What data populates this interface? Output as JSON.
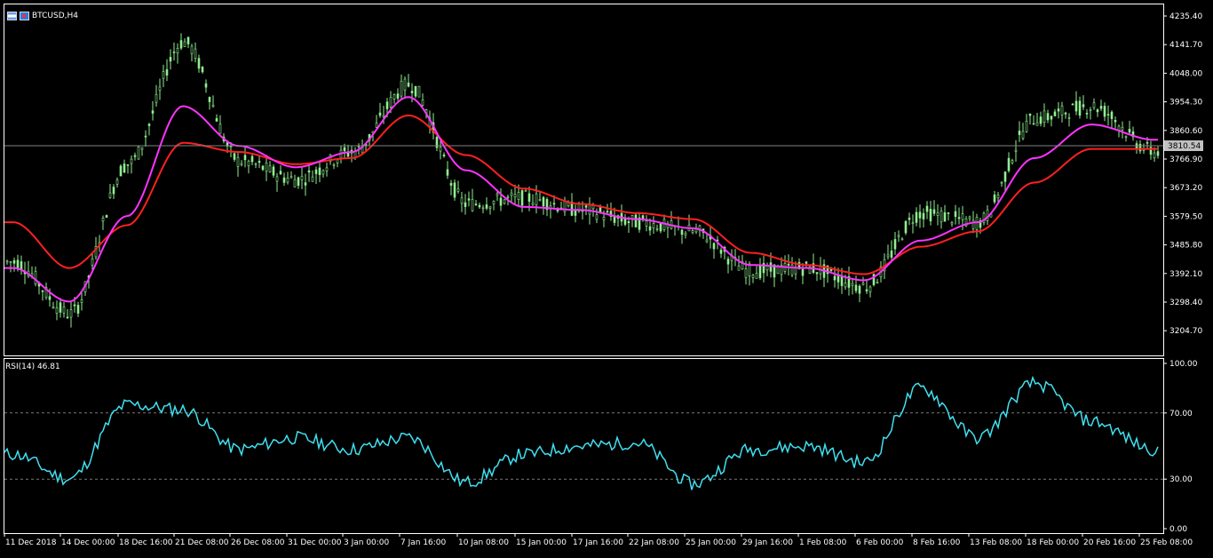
{
  "chart": {
    "symbol": "BTCUSD,H4",
    "price_marker": "3810.54",
    "price_levels": [
      "4235.40",
      "4141.70",
      "4048.00",
      "3954.30",
      "3860.60",
      "3766.90",
      "3673.20",
      "3579.50",
      "3485.80",
      "3392.10",
      "3298.40",
      "3204.70"
    ],
    "time_labels": [
      "11 Dec 2018",
      "14 Dec 00:00",
      "18 Dec 16:00",
      "21 Dec 08:00",
      "26 Dec 08:00",
      "31 Dec 00:00",
      "3 Jan 00:00",
      "7 Jan 16:00",
      "10 Jan 08:00",
      "15 Jan 00:00",
      "17 Jan 16:00",
      "22 Jan 08:00",
      "25 Jan 00:00",
      "29 Jan 16:00",
      "1 Feb 08:00",
      "6 Feb 00:00",
      "8 Feb 16:00",
      "13 Feb 08:00",
      "18 Feb 00:00",
      "20 Feb 16:00",
      "25 Feb 08:00"
    ],
    "rsi_label": "RSI(14) 46.81",
    "rsi_levels": [
      "100.00",
      "70.00",
      "30.00",
      "0.00"
    ],
    "colors": {
      "background": "#000000",
      "candles": "#90ee90",
      "ma_fast": "#ff33ff",
      "ma_slow": "#ff2020",
      "rsi_line": "#40e0f0",
      "axis_text": "#ffffff",
      "price_line": "#808080",
      "marker_bg": "#c0c0c0"
    }
  },
  "chart_data": {
    "type": "line",
    "title": "BTCUSD,H4",
    "xlabel": "",
    "ylabel": "",
    "ylim": [
      3160,
      4260
    ],
    "x": [
      "11 Dec 2018",
      "14 Dec 00:00",
      "18 Dec 16:00",
      "21 Dec 08:00",
      "26 Dec 08:00",
      "31 Dec 00:00",
      "3 Jan 00:00",
      "7 Jan 16:00",
      "10 Jan 08:00",
      "15 Jan 00:00",
      "17 Jan 16:00",
      "22 Jan 08:00",
      "25 Jan 00:00",
      "29 Jan 16:00",
      "1 Feb 08:00",
      "6 Feb 00:00",
      "8 Feb 16:00",
      "13 Feb 08:00",
      "18 Feb 00:00",
      "20 Feb 16:00",
      "25 Feb 08:00"
    ],
    "series": [
      {
        "values": [
          3430,
          3260,
          3750,
          4150,
          3760,
          3700,
          3790,
          4010,
          3620,
          3640,
          3600,
          3560,
          3530,
          3400,
          3410,
          3350,
          3590,
          3560,
          3900,
          3940,
          3790
        ]
      },
      {
        "values": [
          3410,
          3300,
          3580,
          3940,
          3810,
          3740,
          3790,
          3970,
          3730,
          3610,
          3600,
          3570,
          3540,
          3420,
          3410,
          3370,
          3500,
          3560,
          3770,
          3880,
          3830
        ]
      },
      {
        "values": [
          3560,
          3410,
          3550,
          3820,
          3790,
          3750,
          3770,
          3910,
          3780,
          3670,
          3620,
          3590,
          3570,
          3460,
          3420,
          3390,
          3480,
          3530,
          3690,
          3800,
          3800
        ]
      }
    ],
    "rsi": {
      "label": "RSI(14) 46.81",
      "ylim": [
        0,
        100
      ],
      "values": [
        45,
        30,
        75,
        72,
        48,
        55,
        48,
        55,
        28,
        45,
        50,
        52,
        27,
        48,
        50,
        40,
        85,
        55,
        88,
        65,
        48
      ]
    }
  }
}
